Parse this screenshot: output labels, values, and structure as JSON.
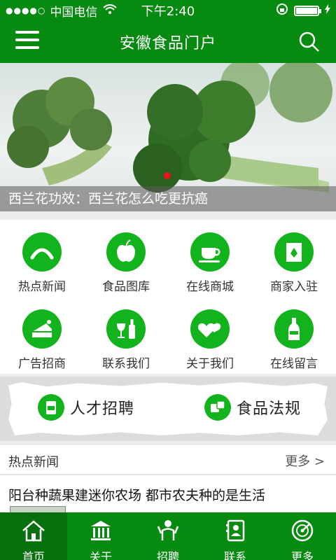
{
  "status": {
    "signal": "●●●●○",
    "carrier": "中国电信",
    "time": "下午2:40"
  },
  "header": {
    "title": "安徽食品门户"
  },
  "banner": {
    "caption": "西兰花功效：西兰花怎么吃更抗癌"
  },
  "grid": [
    {
      "label": "热点新闻",
      "icon": "smile-arc-icon"
    },
    {
      "label": "食品图库",
      "icon": "apple-icon"
    },
    {
      "label": "在线商城",
      "icon": "cup-icon"
    },
    {
      "label": "商家入驻",
      "icon": "leaf-bag-icon"
    },
    {
      "label": "广告招商",
      "icon": "cake-icon"
    },
    {
      "label": "联系我们",
      "icon": "wine-icon"
    },
    {
      "label": "关于我们",
      "icon": "hearts-icon"
    },
    {
      "label": "在线留言",
      "icon": "bottle-icon"
    }
  ],
  "strip": {
    "left_label": "人才招聘",
    "right_label": "食品法规"
  },
  "news": {
    "heading": "热点新闻",
    "more": "更多 >",
    "item_title": "阳台种蔬果建迷你农场 都市农夫种的是生活"
  },
  "tabs": [
    {
      "label": "首页",
      "icon": "home-icon"
    },
    {
      "label": "关于",
      "icon": "building-icon"
    },
    {
      "label": "招聘",
      "icon": "people-icon"
    },
    {
      "label": "联系",
      "icon": "contacts-icon"
    },
    {
      "label": "更多",
      "icon": "radar-icon"
    }
  ],
  "colors": {
    "primary": "#078a10",
    "icon_green": "#13b31e",
    "dot": "#e9141a"
  }
}
